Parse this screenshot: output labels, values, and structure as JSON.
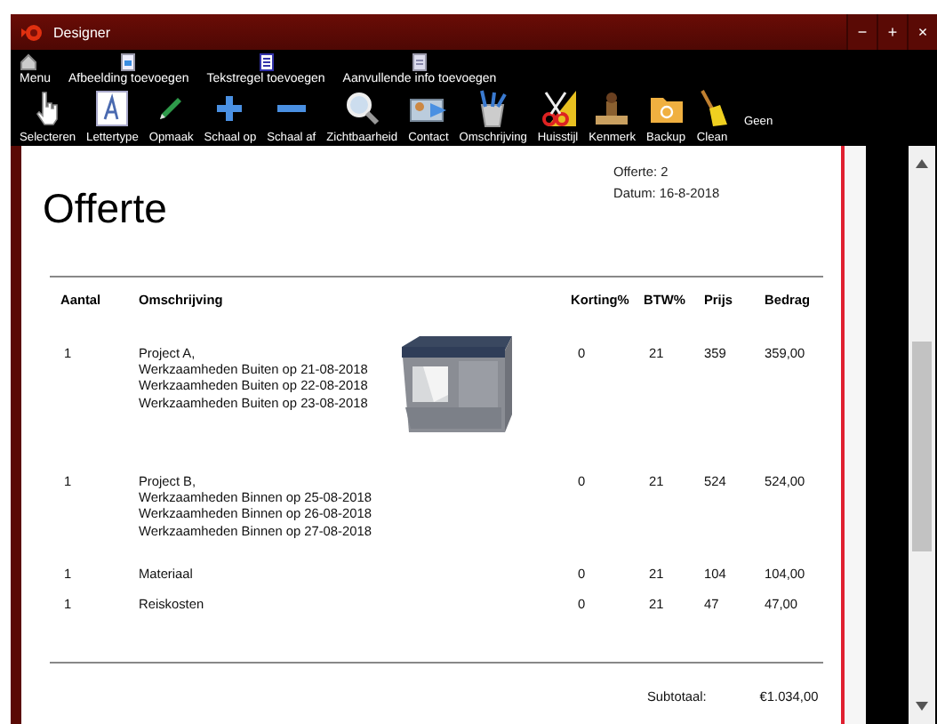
{
  "window": {
    "title": "Designer",
    "controls": [
      "−",
      "+",
      "×"
    ]
  },
  "menu_bar": [
    {
      "label": "Menu"
    },
    {
      "label": "Afbeelding toevoegen"
    },
    {
      "label": "Tekstregel toevoegen"
    },
    {
      "label": "Aanvullende info toevoegen"
    }
  ],
  "toolbar": [
    {
      "label": "Selecteren"
    },
    {
      "label": "Lettertype"
    },
    {
      "label": "Opmaak"
    },
    {
      "label": "Schaal op"
    },
    {
      "label": "Schaal af"
    },
    {
      "label": "Zichtbaarheid"
    },
    {
      "label": "Contact"
    },
    {
      "label": "Omschrijving"
    },
    {
      "label": "Huisstijl"
    },
    {
      "label": "Kenmerk"
    },
    {
      "label": "Backup"
    },
    {
      "label": "Clean"
    }
  ],
  "toolbar_status": "Geen",
  "document": {
    "title": "Offerte",
    "number": "Offerte: 2",
    "date": "Datum: 16-8-2018",
    "columns": [
      "Aantal",
      "Omschrijving",
      "Korting%",
      "BTW%",
      "Prijs",
      "Bedrag"
    ],
    "rows": [
      {
        "aantal": "1",
        "lines": [
          "Project A,",
          "Werkzaamheden Buiten op 21-08-2018",
          "Werkzaamheden Buiten op 22-08-2018",
          "Werkzaamheden Buiten op 23-08-2018"
        ],
        "korting": "0",
        "btw": "21",
        "prijs": "359",
        "bedrag": "359,00"
      },
      {
        "aantal": "1",
        "lines": [
          "Project B,",
          "Werkzaamheden Binnen op 25-08-2018",
          "Werkzaamheden Binnen op 26-08-2018",
          "Werkzaamheden Binnen op 27-08-2018"
        ],
        "korting": "0",
        "btw": "21",
        "prijs": "524",
        "bedrag": "524,00"
      },
      {
        "aantal": "1",
        "lines": [
          "Materiaal"
        ],
        "korting": "0",
        "btw": "21",
        "prijs": "104",
        "bedrag": "104,00"
      },
      {
        "aantal": "1",
        "lines": [
          "Reiskosten"
        ],
        "korting": "0",
        "btw": "21",
        "prijs": "47",
        "bedrag": "47,00"
      }
    ],
    "subtotal_label": "Subtotaal:",
    "subtotal": "€1.034,00"
  }
}
